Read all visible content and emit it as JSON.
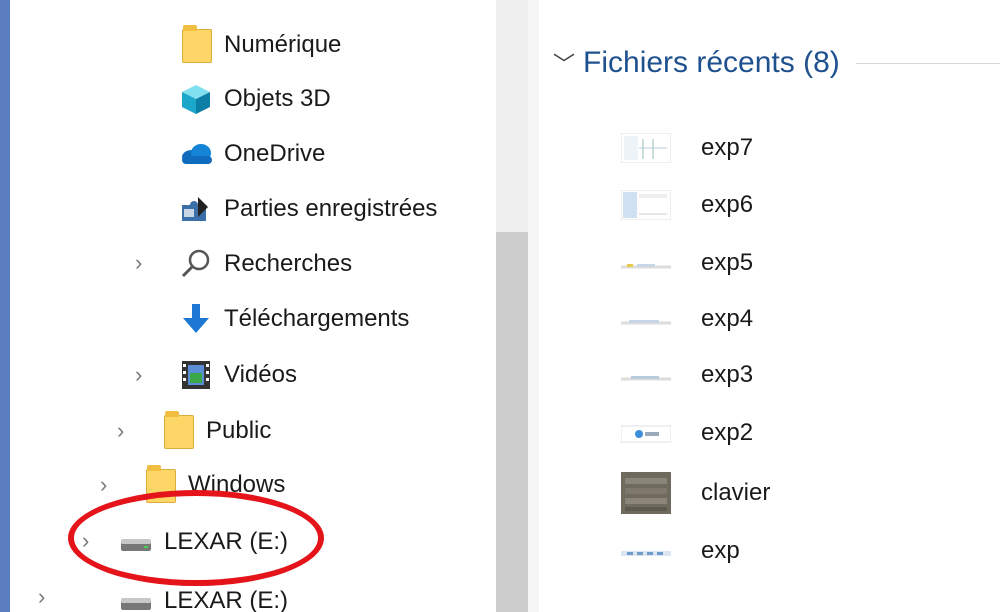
{
  "nav": {
    "items": [
      {
        "label": "Numérique",
        "icon": "folder-icon"
      },
      {
        "label": "Objets 3D",
        "icon": "cube-3d-icon"
      },
      {
        "label": "OneDrive",
        "icon": "cloud-icon"
      },
      {
        "label": "Parties enregistrées",
        "icon": "puzzle-icon"
      },
      {
        "label": "Recherches",
        "icon": "search-icon",
        "expandable": true
      },
      {
        "label": "Téléchargements",
        "icon": "download-arrow-icon"
      },
      {
        "label": "Vidéos",
        "icon": "video-icon",
        "expandable": true
      },
      {
        "label": "Public",
        "icon": "folder-icon",
        "expandable": true
      },
      {
        "label": "Windows",
        "icon": "folder-icon",
        "expandable": true
      },
      {
        "label": "LEXAR (E:)",
        "icon": "drive-icon",
        "expandable": true
      },
      {
        "label": "LEXAR (E:)",
        "icon": "drive-icon",
        "expandable": true
      }
    ]
  },
  "recent": {
    "title": "Fichiers récents (8)",
    "files": [
      {
        "name": "exp7"
      },
      {
        "name": "exp6"
      },
      {
        "name": "exp5"
      },
      {
        "name": "exp4"
      },
      {
        "name": "exp3"
      },
      {
        "name": "exp2"
      },
      {
        "name": "clavier"
      },
      {
        "name": "exp"
      }
    ]
  },
  "colors": {
    "accent": "#20518f",
    "annotation": "#e4141a",
    "folder": "#fcd768"
  }
}
